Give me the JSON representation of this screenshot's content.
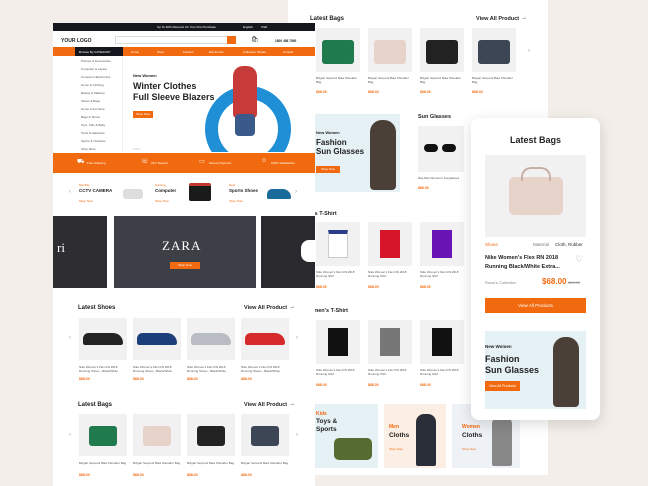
{
  "left": {
    "topbar": {
      "promo": "Up To 30% Discount On Your First Purchase",
      "lang": "English",
      "currency": "USD"
    },
    "header": {
      "logo": "YOUR LOGO",
      "cart": "Cart",
      "phone": "1800 456 7890"
    },
    "nav": {
      "categories": "Browse By CATEGORY",
      "items": [
        "Home",
        "Shop",
        "Fashion",
        "Electronics",
        "Collection Modes",
        "Contact"
      ]
    },
    "sidebar": [
      "Phones & Accessories",
      "Computer & Laptop",
      "Consumer Electronics",
      "Home & Clothing",
      "Beauty & Makeup",
      "Shoes & Bags",
      "Home & Furniture",
      "Bags & Shoes",
      "Toys, Kids & Baby",
      "Tools & Hardware",
      "Sports & Outdoors",
      "Shop More"
    ],
    "hero": {
      "tag": "New Women",
      "title1": "Winter Clothes",
      "title2": "Full Sleeve Blazers",
      "btn": "Shop Now"
    },
    "features": [
      "Free Shipping",
      "24/7 Support",
      "Secure Payment",
      "100% Satisfaction"
    ],
    "promos": [
      {
        "tag": "Monthly",
        "title": "CCTV CAMERA",
        "link": "Shop Now"
      },
      {
        "tag": "Gaming",
        "title": "Computer",
        "link": "Shop Now"
      },
      {
        "tag": "New",
        "title": "Sports Shoes",
        "link": "Shop Now"
      }
    ],
    "brand": {
      "left": "ri",
      "center": "ZARA",
      "btn": "Shop Now"
    },
    "shoes": {
      "title": "Latest Shoes",
      "viewall": "View All Product",
      "item": "Nike Women's Flex RN 2018 Running Shoes - Black/White",
      "price": "$68.00"
    },
    "bags": {
      "title": "Latest Bags",
      "viewall": "View All Product",
      "item": "Bvlgari Serpenti Baia Shoulder Bag",
      "price": "$68.00"
    }
  },
  "middle": {
    "bags": {
      "title": "Latest Bags",
      "viewall": "View All Product",
      "item": "Bvlgari Serpenti Baia Shoulder Bag",
      "price": "$68.00"
    },
    "fashion": {
      "tag": "New Women",
      "title1": "Fashion",
      "title2": "Sun Glasses",
      "btn": "Shop Now"
    },
    "sunglasses": {
      "title": "Sun Glasses",
      "item": "Ray-Ban Women's Sunglasses",
      "price": "$68.00"
    },
    "mens": {
      "title": "n's T-Shirt",
      "item": "Nike Women's Flex RN 2018 Running Shirt",
      "price": "$68.00"
    },
    "womens": {
      "title": "omen's T-Shirt",
      "item": "Nike Women's Flex RN 2018 Running Shirt",
      "price": "$68.00"
    },
    "cats": [
      {
        "title1": "Kids",
        "title2": "Toys &",
        "title3": "Sports",
        "link": "Shop Now"
      },
      {
        "title1": "Men",
        "title2": "Cloths",
        "link": "Shop Now"
      },
      {
        "title1": "Women",
        "title2": "Cloths",
        "link": "Shop Now"
      }
    ]
  },
  "mobile": {
    "title": "Latest Bags",
    "category": "Shoes",
    "material_label": "Material",
    "material_value": "Cloth, Rubber",
    "name": "Nike Women's Flex RN 2018 Running Black/White Extra...",
    "collection": "Rossi's Collection",
    "price": "$68.00",
    "old_price": "$80.00",
    "all_btn": "View All Products",
    "promo": {
      "tag": "New Women",
      "title1": "Fashion",
      "title2": "Sun Glasses",
      "btn": "View All Products"
    }
  }
}
